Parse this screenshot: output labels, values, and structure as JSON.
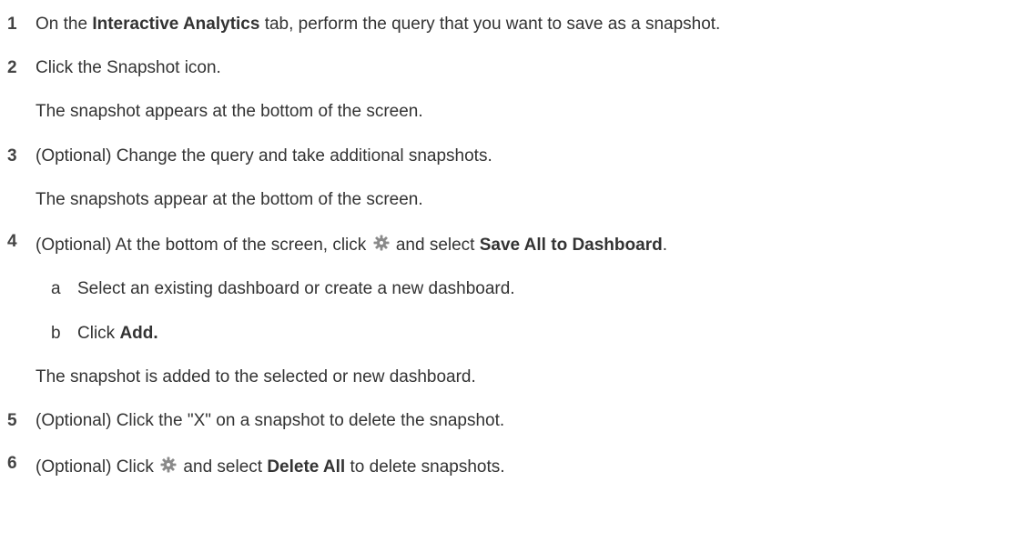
{
  "steps": [
    {
      "number": "1",
      "pre": "On the ",
      "bold": "Interactive Analytics",
      "post": " tab, perform the query that you want to save as a snapshot."
    },
    {
      "number": "2",
      "text": "Click the Snapshot icon.",
      "result": "The snapshot appears at the bottom of the screen."
    },
    {
      "number": "3",
      "text": "(Optional) Change the query and take additional snapshots.",
      "result": "The snapshots appear at the bottom of the screen."
    },
    {
      "number": "4",
      "pre": "(Optional) At the bottom of the screen, click ",
      "icon": "gear-icon",
      "mid": " and select ",
      "bold": "Save All to Dashboard",
      "post": ".",
      "substeps": [
        {
          "letter": "a",
          "text": "Select an existing dashboard or create a new dashboard."
        },
        {
          "letter": "b",
          "pre": "Click ",
          "bold": "Add."
        }
      ],
      "result": "The snapshot is added to the selected or new dashboard."
    },
    {
      "number": "5",
      "text": "(Optional) Click the \"X\" on a snapshot to delete the snapshot."
    },
    {
      "number": "6",
      "pre": "(Optional) Click ",
      "icon": "gear-icon",
      "mid": " and select ",
      "bold": "Delete All",
      "post": " to delete snapshots."
    }
  ],
  "colors": {
    "text": "#333333",
    "gear": "#8a8a8a"
  }
}
